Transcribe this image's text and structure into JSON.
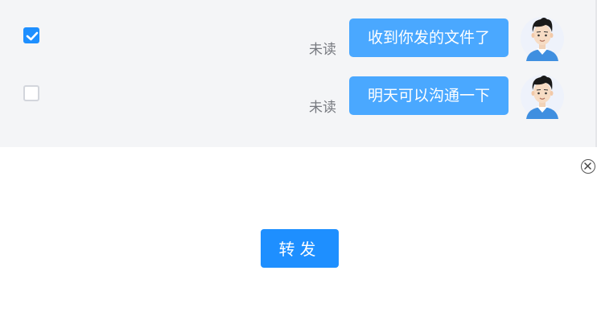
{
  "messages": [
    {
      "text": "收到你发的文件了",
      "status": "未读",
      "selected": true
    },
    {
      "text": "明天可以沟通一下",
      "status": "未读",
      "selected": false
    }
  ],
  "actions": {
    "forward_label": "转发"
  },
  "icons": {
    "checkbox_checked": "check-icon",
    "close": "close-circle-icon",
    "avatar": "user-avatar-icon"
  },
  "colors": {
    "accent": "#1e8fff",
    "bubble": "#4aa8ff",
    "chat_background": "#f4f5f7"
  }
}
